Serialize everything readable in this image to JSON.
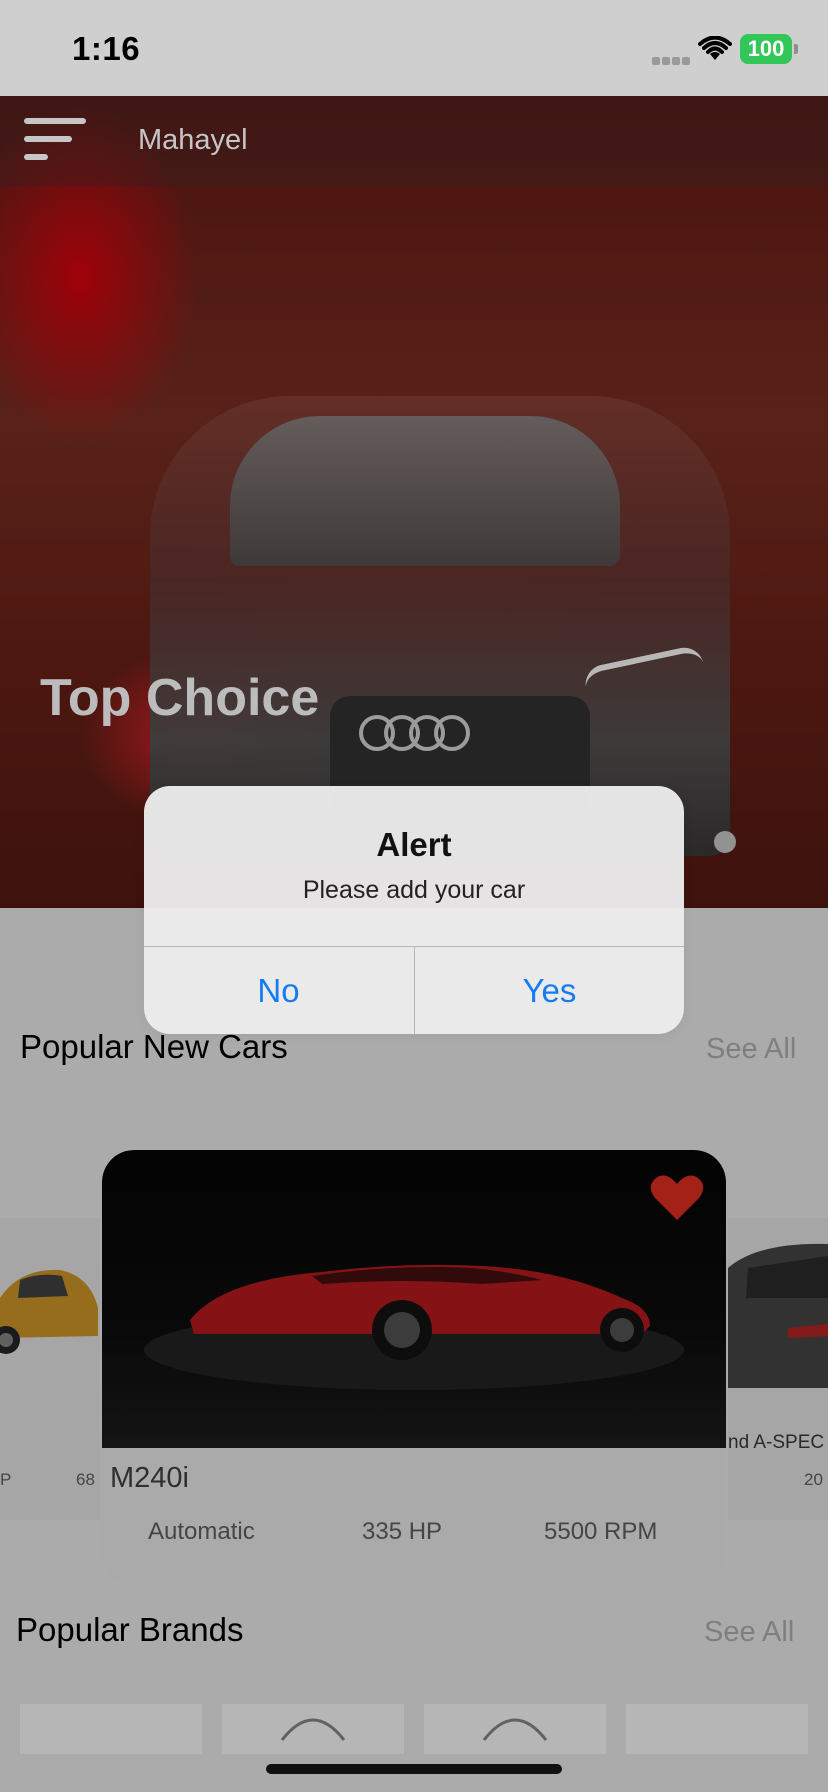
{
  "status_bar": {
    "time": "1:16",
    "battery": "100"
  },
  "nav": {
    "title": "Mahayel"
  },
  "hero": {
    "title": "Top Choice"
  },
  "popular_cars": {
    "title": "Popular New Cars",
    "see_all": "See All",
    "left_card": {
      "spec_a": "P",
      "spec_b": "68"
    },
    "featured": {
      "name": "M240i",
      "transmission": "Automatic",
      "power": "335 HP",
      "rpm": "5500 RPM"
    },
    "right_card": {
      "name": "nd A-SPEC",
      "spec": "20"
    }
  },
  "popular_brands": {
    "title": "Popular Brands",
    "see_all": "See All"
  },
  "alert": {
    "title": "Alert",
    "message": "Please add your car",
    "no_label": "No",
    "yes_label": "Yes"
  },
  "colors": {
    "accent": "#157cf0",
    "heart": "#c8291e",
    "battery": "#33c759"
  }
}
